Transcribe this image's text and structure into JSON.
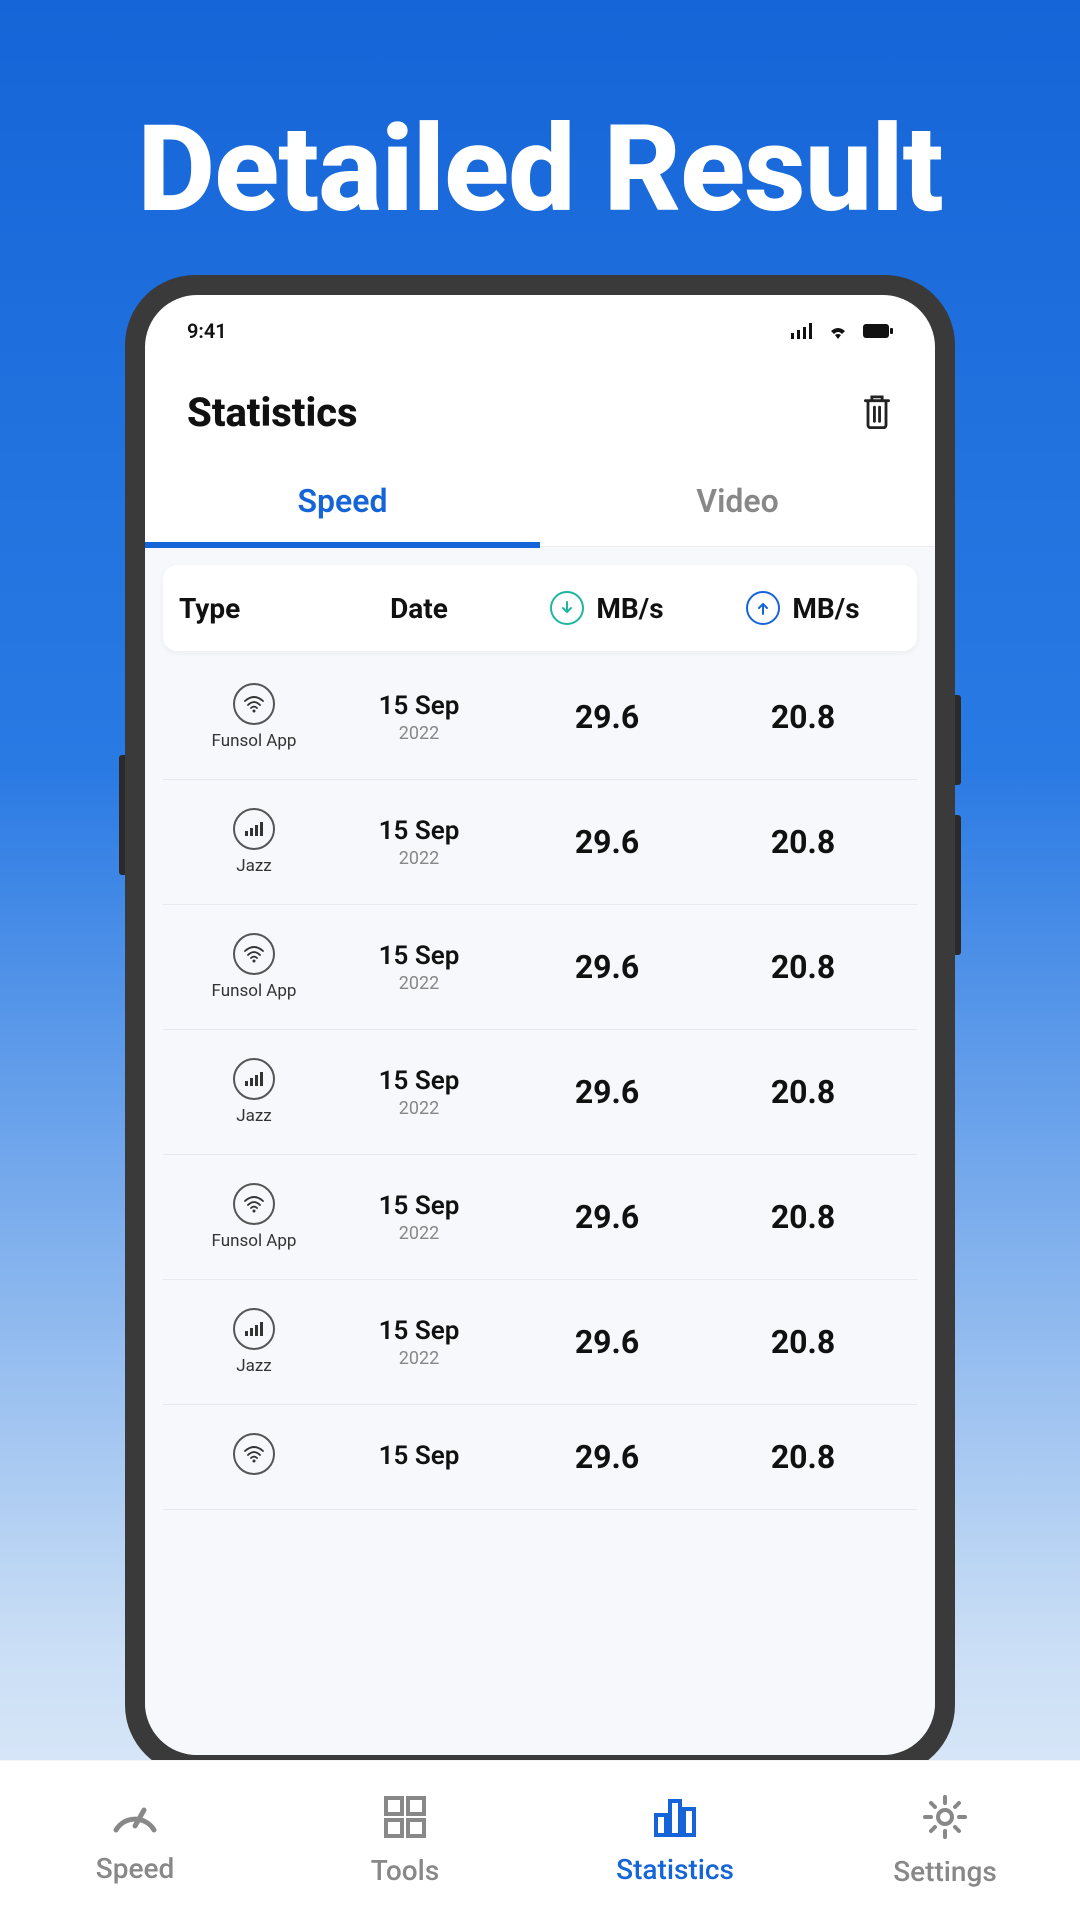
{
  "hero": {
    "title": "Detailed Result"
  },
  "statusbar": {
    "time": "9:41"
  },
  "header": {
    "title": "Statistics"
  },
  "tabs": [
    {
      "label": "Speed",
      "active": true
    },
    {
      "label": "Video",
      "active": false
    }
  ],
  "columns": {
    "type": "Type",
    "date": "Date",
    "down_unit": "MB/s",
    "up_unit": "MB/s"
  },
  "rows": [
    {
      "icon": "wifi",
      "type_label": "Funsol App",
      "date": "15 Sep",
      "year": "2022",
      "down": "29.6",
      "up": "20.8"
    },
    {
      "icon": "cell",
      "type_label": "Jazz",
      "date": "15 Sep",
      "year": "2022",
      "down": "29.6",
      "up": "20.8"
    },
    {
      "icon": "wifi",
      "type_label": "Funsol App",
      "date": "15 Sep",
      "year": "2022",
      "down": "29.6",
      "up": "20.8"
    },
    {
      "icon": "cell",
      "type_label": "Jazz",
      "date": "15 Sep",
      "year": "2022",
      "down": "29.6",
      "up": "20.8"
    },
    {
      "icon": "wifi",
      "type_label": "Funsol App",
      "date": "15 Sep",
      "year": "2022",
      "down": "29.6",
      "up": "20.8"
    },
    {
      "icon": "cell",
      "type_label": "Jazz",
      "date": "15 Sep",
      "year": "2022",
      "down": "29.6",
      "up": "20.8"
    },
    {
      "icon": "wifi",
      "type_label": "",
      "date": "15 Sep",
      "year": "",
      "down": "29.6",
      "up": "20.8"
    }
  ],
  "bottom_nav": [
    {
      "label": "Speed",
      "icon": "speed",
      "active": false
    },
    {
      "label": "Tools",
      "icon": "tools",
      "active": false
    },
    {
      "label": "Statistics",
      "icon": "stats",
      "active": true
    },
    {
      "label": "Settings",
      "icon": "settings",
      "active": false
    }
  ]
}
